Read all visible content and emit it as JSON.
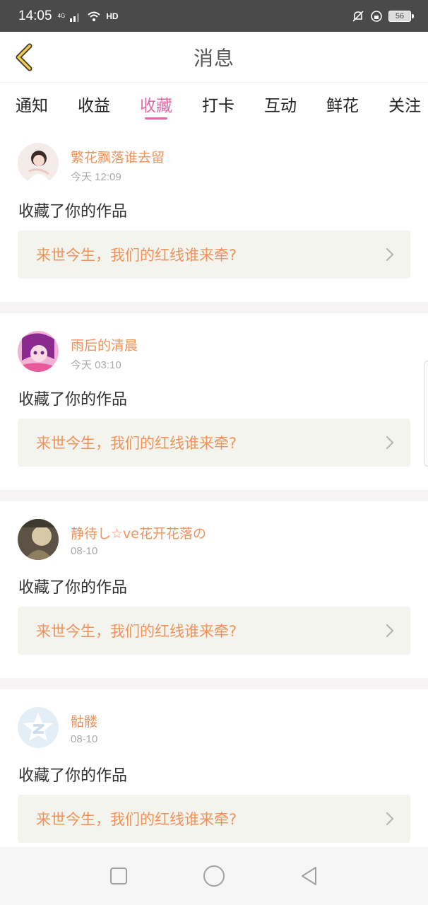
{
  "status_bar": {
    "time": "14:05",
    "network": "4G",
    "hd": "HD",
    "battery": "56"
  },
  "header": {
    "title": "消息"
  },
  "tabs": [
    {
      "label": "通知"
    },
    {
      "label": "收益"
    },
    {
      "label": "收藏"
    },
    {
      "label": "打卡"
    },
    {
      "label": "互动"
    },
    {
      "label": "鲜花"
    },
    {
      "label": "关注"
    }
  ],
  "active_tab": "收藏",
  "messages": [
    {
      "username": "繁花飘落谁去留",
      "time": "今天 12:09",
      "action": "收藏了你的作品",
      "work_title": "来世今生，我们的红线谁来牵?"
    },
    {
      "username": "雨后的清晨",
      "time": "今天 03:10",
      "action": "收藏了你的作品",
      "work_title": "来世今生，我们的红线谁来牵?"
    },
    {
      "username": "静待し☆ve花开花落の",
      "time": "08-10",
      "action": "收藏了你的作品",
      "work_title": "来世今生，我们的红线谁来牵?"
    },
    {
      "username": "骷髅",
      "time": "08-10",
      "action": "收藏了你的作品",
      "work_title": "来世今生，我们的红线谁来牵?"
    }
  ],
  "colors": {
    "accent_pink": "#e26aa5",
    "username_orange": "#f0925a",
    "back_yellow": "#f2c94c"
  }
}
